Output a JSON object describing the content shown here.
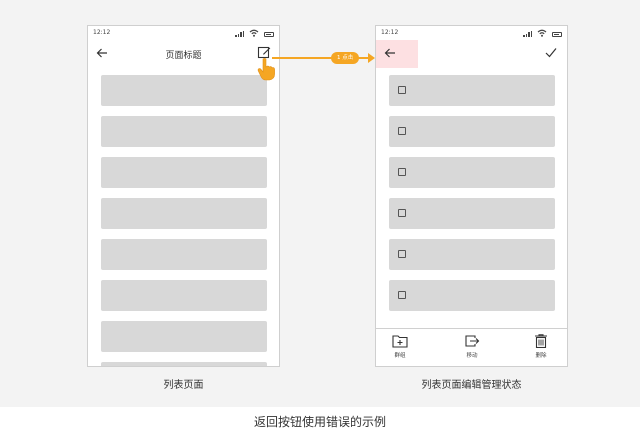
{
  "left_screen": {
    "status_time": "12:12",
    "nav_title": "页面标题",
    "caption": "列表页面",
    "item_count": 8
  },
  "right_screen": {
    "status_time": "12:12",
    "caption": "列表页面编辑管理状态",
    "item_count": 6,
    "toolbar": {
      "group_label": "群组",
      "move_label": "移动",
      "delete_label": "删除"
    }
  },
  "annotation": {
    "badge": "1 点击",
    "color": "#f5a623"
  },
  "footer_caption": "返回按钮使用错误的示例",
  "colors": {
    "list_item": "#d8d8d8",
    "highlight": "#fde0e2",
    "stage_background": "#f3f3f3"
  },
  "icons": [
    "back-arrow-icon",
    "edit-icon",
    "check-icon",
    "checkbox-icon",
    "folder-add-icon",
    "move-icon",
    "trash-icon",
    "hand-pointer-icon",
    "signal-icon",
    "wifi-icon",
    "battery-icon"
  ]
}
